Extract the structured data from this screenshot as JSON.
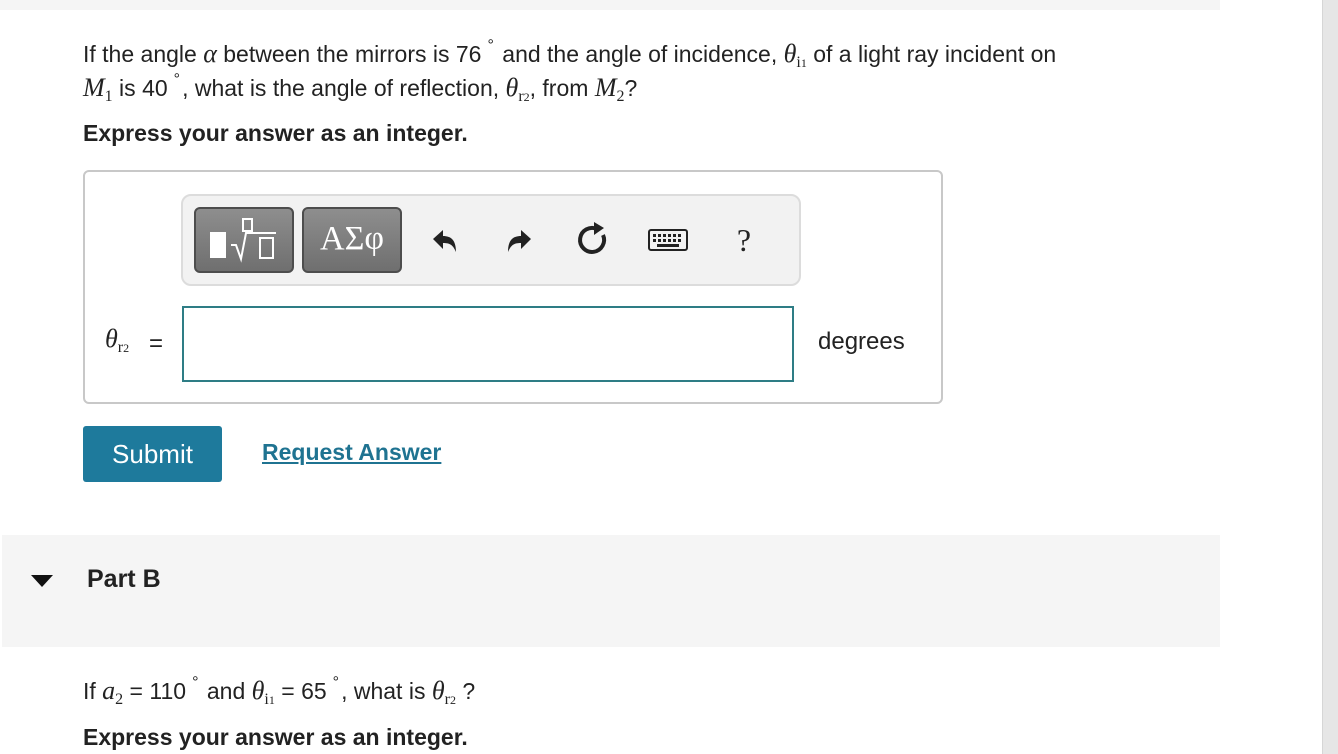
{
  "partA": {
    "question": {
      "p1": "If the angle ",
      "alpha": "α",
      "p2": " between the mirrors is ",
      "angle_between": "76",
      "deg": "°",
      "p3": " and the angle of incidence, ",
      "theta": "θ",
      "sub_i1": "i",
      "sub_i1_num": "1",
      "p4": " of a light ray incident on",
      "M": "M",
      "one": "1",
      "p5": " is ",
      "incidence": "40",
      "p6": ", what is the angle of reflection, ",
      "sub_r2": "r",
      "sub_r2_num": "2",
      "p7": ", from ",
      "two": "2",
      "p8": "?"
    },
    "instruction": "Express your answer as an integer.",
    "toolbar": {
      "templates_label": "templates",
      "greek_label": "ΑΣφ",
      "help_label": "?"
    },
    "answer": {
      "eq": "=",
      "value": "",
      "unit": "degrees"
    },
    "submit_label": "Submit",
    "request_label": "Request Answer"
  },
  "partB": {
    "title": "Part B",
    "question": {
      "p1": "If ",
      "a": "a",
      "a_sub": "2",
      "p2": " = ",
      "a_val": "110",
      "deg": "°",
      "p3": " and ",
      "theta": "θ",
      "sub_i": "i",
      "sub_1": "1",
      "p4": " = ",
      "theta_val": "65",
      "p5": ", what is ",
      "sub_r": "r",
      "sub_2": "2",
      "p6": " ?"
    },
    "instruction": "Express your answer as an integer."
  },
  "colors": {
    "submit": "#1e7a9c",
    "link": "#1f7391",
    "input_border": "#2e7d85",
    "panel_bg": "#f5f5f5"
  },
  "icons": [
    "templates-icon",
    "greek-symbols-icon",
    "undo-icon",
    "redo-icon",
    "reset-icon",
    "keyboard-icon",
    "help-icon",
    "collapse-triangle-icon"
  ]
}
